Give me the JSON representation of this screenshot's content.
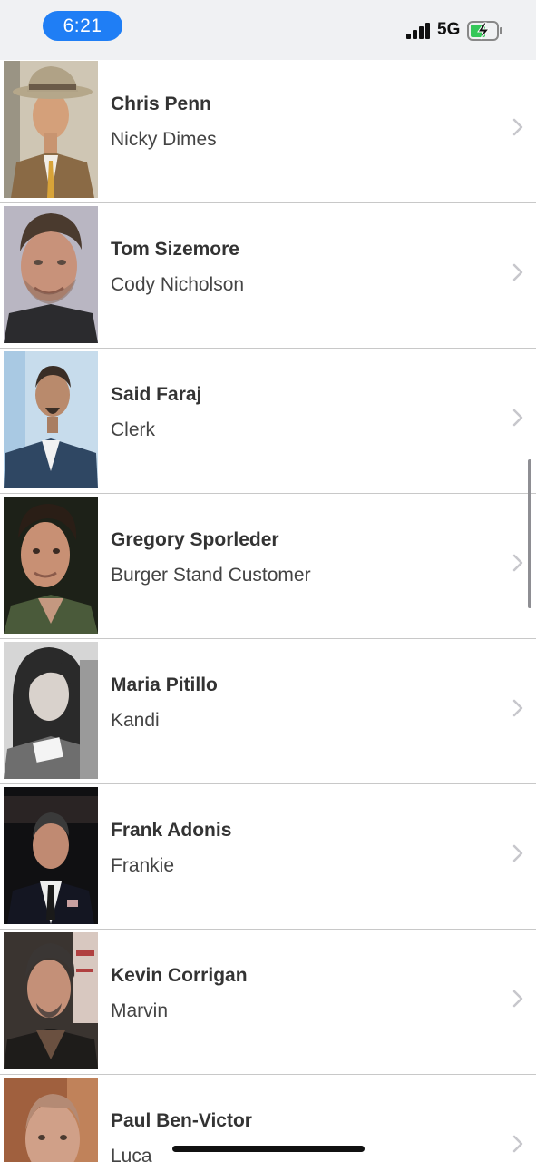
{
  "status_bar": {
    "time": "6:21",
    "network": "5G",
    "icons": [
      "signal-icon",
      "battery-charging-icon"
    ],
    "accent_color": "#1f7ef5"
  },
  "cast": [
    {
      "actor": "Chris Penn",
      "role": "Nicky Dimes",
      "photo": "actor-photo"
    },
    {
      "actor": "Tom Sizemore",
      "role": "Cody Nicholson",
      "photo": "actor-photo"
    },
    {
      "actor": "Said Faraj",
      "role": "Clerk",
      "photo": "actor-photo"
    },
    {
      "actor": "Gregory Sporleder",
      "role": "Burger Stand Customer",
      "photo": "actor-photo"
    },
    {
      "actor": "Maria Pitillo",
      "role": "Kandi",
      "photo": "actor-photo"
    },
    {
      "actor": "Frank Adonis",
      "role": "Frankie",
      "photo": "actor-photo"
    },
    {
      "actor": "Kevin Corrigan",
      "role": "Marvin",
      "photo": "actor-photo"
    },
    {
      "actor": "Paul Ben-Victor",
      "role": "Luca",
      "photo": "actor-photo"
    }
  ]
}
